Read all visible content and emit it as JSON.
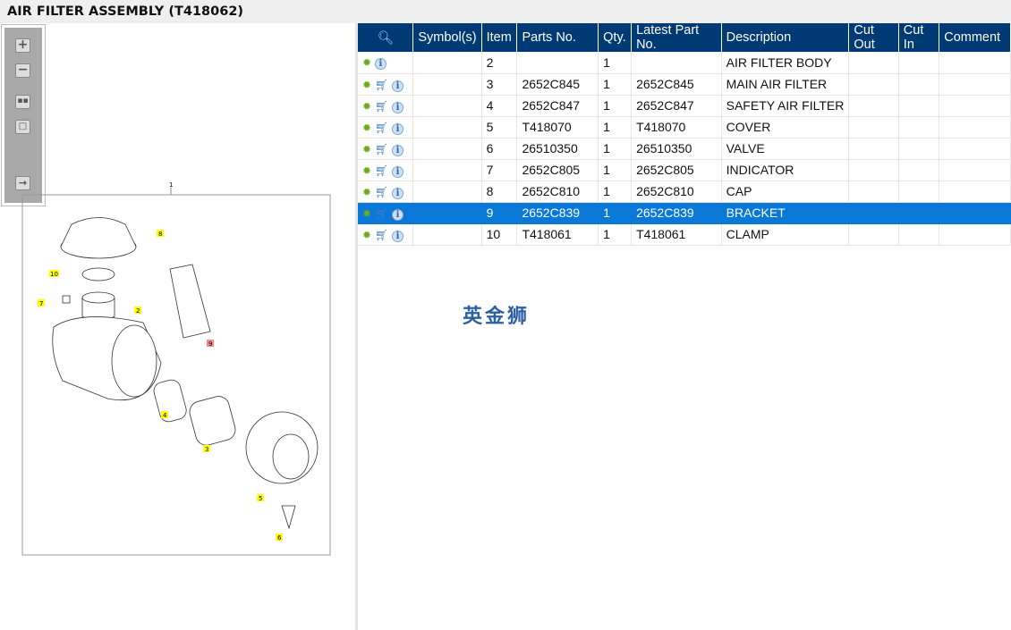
{
  "title": "AIR FILTER ASSEMBLY (T418062)",
  "watermark": "英金狮",
  "diagram": {
    "callouts": [
      "1",
      "2",
      "3",
      "4",
      "5",
      "6",
      "7",
      "8",
      "9",
      "10"
    ]
  },
  "table": {
    "headers": [
      "",
      "Symbol(s)",
      "Item",
      "Parts No.",
      "Qty.",
      "Latest Part No.",
      "Description",
      "Cut Out",
      "Cut In",
      "Comment"
    ],
    "rows": [
      {
        "item": "2",
        "part": "",
        "qty": "1",
        "latest": "",
        "desc": "AIR FILTER BODY",
        "cart": false
      },
      {
        "item": "3",
        "part": "2652C845",
        "qty": "1",
        "latest": "2652C845",
        "desc": "MAIN AIR FILTER",
        "cart": true
      },
      {
        "item": "4",
        "part": "2652C847",
        "qty": "1",
        "latest": "2652C847",
        "desc": "SAFETY AIR FILTER",
        "cart": true
      },
      {
        "item": "5",
        "part": "T418070",
        "qty": "1",
        "latest": "T418070",
        "desc": "COVER",
        "cart": true
      },
      {
        "item": "6",
        "part": "26510350",
        "qty": "1",
        "latest": "26510350",
        "desc": "VALVE",
        "cart": true
      },
      {
        "item": "7",
        "part": "2652C805",
        "qty": "1",
        "latest": "2652C805",
        "desc": "INDICATOR",
        "cart": true
      },
      {
        "item": "8",
        "part": "2652C810",
        "qty": "1",
        "latest": "2652C810",
        "desc": "CAP",
        "cart": true
      },
      {
        "item": "9",
        "part": "2652C839",
        "qty": "1",
        "latest": "2652C839",
        "desc": "BRACKET",
        "cart": true,
        "selected": true
      },
      {
        "item": "10",
        "part": "T418061",
        "qty": "1",
        "latest": "T418061",
        "desc": "CLAMP",
        "cart": true
      }
    ]
  }
}
